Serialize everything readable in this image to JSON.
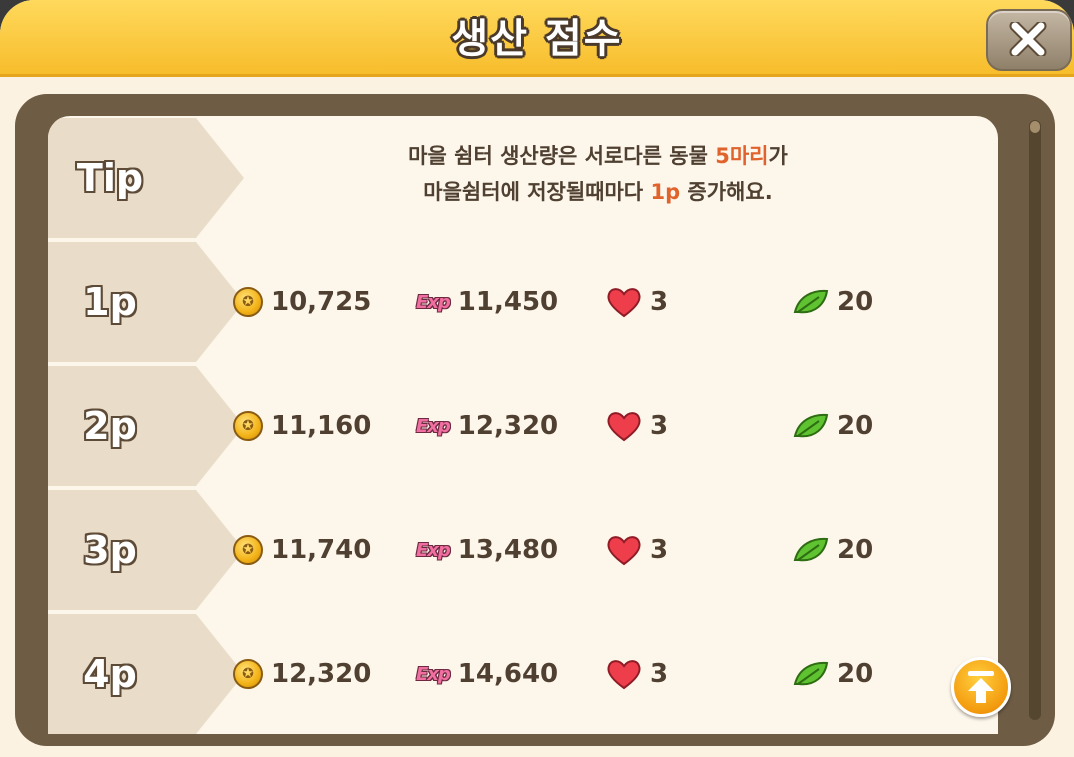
{
  "header": {
    "title": "생산 점수"
  },
  "close": {
    "icon": "close-icon"
  },
  "tip": {
    "label": "Tip",
    "line1_prefix": "마을 쉼터 생산량은 서로다른 동물 ",
    "line1_highlight": "5마리",
    "line1_suffix": "가",
    "line2_prefix": "마을쉼터에 저장될때마다 ",
    "line2_highlight": "1p",
    "line2_suffix": " 증가해요.",
    "highlight_color": "#e0622c"
  },
  "icons": {
    "coin": "coin-icon",
    "exp": "Exp",
    "heart": "heart-icon",
    "leaf": "leaf-icon"
  },
  "rows": [
    {
      "label": "1p",
      "coins": "10,725",
      "exp": "11,450",
      "hearts": "3",
      "leaves": "20"
    },
    {
      "label": "2p",
      "coins": "11,160",
      "exp": "12,320",
      "hearts": "3",
      "leaves": "20"
    },
    {
      "label": "3p",
      "coins": "11,740",
      "exp": "13,480",
      "hearts": "3",
      "leaves": "20"
    },
    {
      "label": "4p",
      "coins": "12,320",
      "exp": "14,640",
      "hearts": "3",
      "leaves": "20"
    }
  ],
  "scroll_top": {
    "icon": "arrow-up-icon"
  }
}
